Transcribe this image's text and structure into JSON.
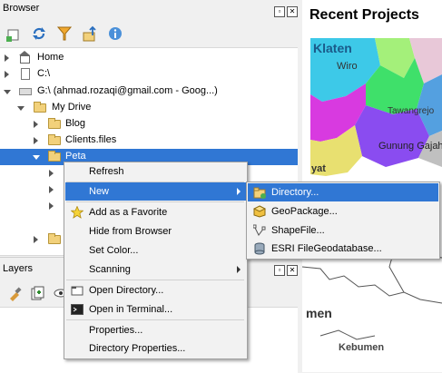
{
  "browser": {
    "title": "Browser",
    "items": [
      {
        "label": "Home"
      },
      {
        "label": "C:\\"
      },
      {
        "label": "G:\\ (ahmad.rozaqi@gmail.com - Goog...)"
      },
      {
        "label": "My Drive"
      },
      {
        "label": "Blog"
      },
      {
        "label": "Clients.files"
      },
      {
        "label": "Peta"
      }
    ]
  },
  "layers": {
    "title": "Layers"
  },
  "map": {
    "title": "Recent Projects",
    "labels": [
      "Klaten",
      "Wiro",
      "Tawangrejo",
      "Gunung Gajah",
      "yat",
      "men",
      "Kebumen"
    ]
  },
  "context_menu": {
    "items": [
      {
        "label": "Refresh"
      },
      {
        "label": "New"
      },
      {
        "label": "Add as a Favorite"
      },
      {
        "label": "Hide from Browser"
      },
      {
        "label": "Set Color..."
      },
      {
        "label": "Scanning"
      },
      {
        "label": "Open Directory..."
      },
      {
        "label": "Open in Terminal..."
      },
      {
        "label": "Properties..."
      },
      {
        "label": "Directory Properties..."
      }
    ]
  },
  "new_submenu": {
    "items": [
      {
        "label": "Directory..."
      },
      {
        "label": "GeoPackage..."
      },
      {
        "label": "ShapeFile..."
      },
      {
        "label": "ESRI FileGeodatabase..."
      }
    ]
  },
  "colors": {
    "selection": "#3077d4",
    "accent_blue": "#2a6fbf"
  }
}
